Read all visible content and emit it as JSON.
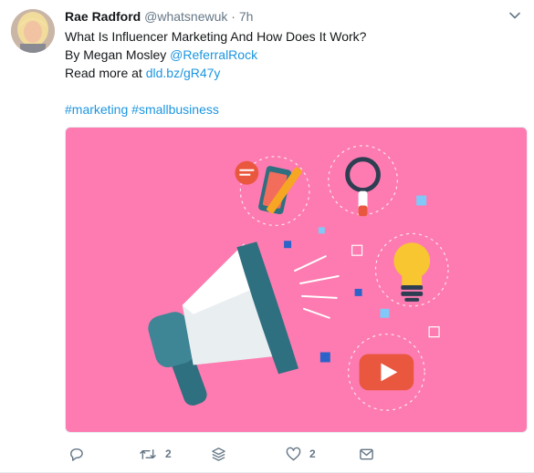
{
  "tweet": {
    "author_name": "Rae Radford",
    "author_handle": "@whatsnewuk",
    "separator": "·",
    "time": "7h",
    "text_line1": "What Is Influencer Marketing And How Does It Work?",
    "text_line2_prefix": "By Megan Mosley ",
    "mention": "@ReferralRock",
    "text_line3_prefix": "Read more at ",
    "link": "dld.bz/gR47y",
    "hashtags": [
      "#marketing",
      "#smallbusiness"
    ]
  },
  "actions": {
    "reply_count": "",
    "retweet_count": "2",
    "like_count": "2"
  },
  "colors": {
    "media_background": "#fd7bb0",
    "link": "#1b95e0",
    "muted": "#657786"
  },
  "icons": {
    "caret": "chevron-down-icon",
    "reply": "reply-icon",
    "retweet": "retweet-icon",
    "buffer": "buffer-stack-icon",
    "like": "heart-icon",
    "dm": "envelope-icon"
  }
}
